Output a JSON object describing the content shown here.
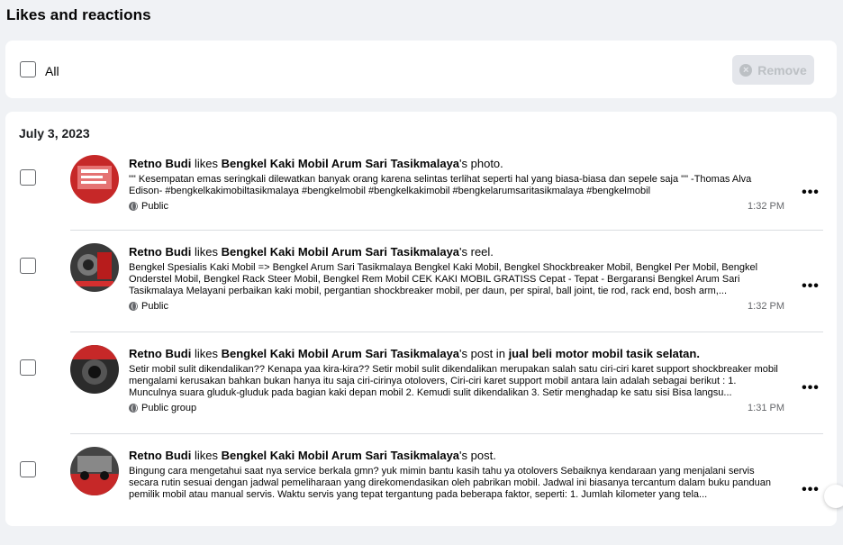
{
  "page": {
    "title": "Likes and reactions"
  },
  "toolbar": {
    "all_label": "All",
    "remove_label": "Remove"
  },
  "date_header": "July 3, 2023",
  "items": [
    {
      "actor": "Retno Budi",
      "verb": "likes",
      "page": "Bengkel Kaki Mobil Arum Sari Tasikmalaya",
      "suffix": "'s photo.",
      "group": "",
      "body": "\"\" Kesempatan emas seringkali dilewatkan banyak orang karena selintas terlihat seperti hal yang biasa-biasa dan sepele saja \"\" -Thomas Alva Edison- #bengkelkakimobiltasikmalaya #bengkelmobil #bengkelkakimobil #bengkelarumsaritasikmalaya #bengkelmobil",
      "privacy": "Public",
      "time": "1:32 PM",
      "thumb_color": "#c62828"
    },
    {
      "actor": "Retno Budi",
      "verb": "likes",
      "page": "Bengkel Kaki Mobil Arum Sari Tasikmalaya",
      "suffix": "'s reel.",
      "group": "",
      "body": "Bengkel Spesialis Kaki Mobil => Bengkel Arum Sari Tasikmalaya Bengkel Kaki Mobil, Bengkel Shockbreaker Mobil, Bengkel Per Mobil, Bengkel Onderstel Mobil, Bengkel Rack Steer Mobil, Bengkel Rem Mobil CEK KAKI MOBIL GRATISS Cepat - Tepat - Bergaransi Bengkel Arum Sari Tasikmalaya Melayani perbaikan kaki mobil, pergantian shockbreaker mobil, per daun, per spiral, ball joint, tie rod, rack end, bosh arm,...",
      "privacy": "Public",
      "time": "1:32 PM",
      "thumb_color": "#3a3a3a"
    },
    {
      "actor": "Retno Budi",
      "verb": "likes",
      "page": "Bengkel Kaki Mobil Arum Sari Tasikmalaya",
      "suffix": "'s post in",
      "group": "jual beli motor mobil tasik selatan.",
      "body": "Setir mobil sulit dikendalikan?? Kenapa yaa kira-kira?? Setir mobil sulit dikendalikan merupakan salah satu ciri-ciri karet support shockbreaker mobil mengalami kerusakan bahkan bukan hanya itu saja ciri-cirinya otolovers, Ciri-ciri karet support mobil antara lain adalah sebagai berikut : 1. Munculnya suara gluduk-gluduk pada bagian kaki depan mobil 2. Kemudi sulit dikendalikan 3. Setir menghadap ke satu sisi Bisa langsu...",
      "privacy": "Public group",
      "time": "1:31 PM",
      "thumb_color": "#2b2b2b"
    },
    {
      "actor": "Retno Budi",
      "verb": "likes",
      "page": "Bengkel Kaki Mobil Arum Sari Tasikmalaya",
      "suffix": "'s post.",
      "group": "",
      "body": "Bingung cara mengetahui saat nya service berkala gmn? yuk mimin bantu kasih tahu ya otolovers Sebaiknya kendaraan yang menjalani servis secara rutin sesuai dengan jadwal pemeliharaan yang direkomendasikan oleh pabrikan mobil. Jadwal ini biasanya tercantum dalam buku panduan pemilik mobil atau manual servis. Waktu servis yang tepat tergantung pada beberapa faktor, seperti: 1. Jumlah kilometer yang tela...",
      "privacy": "",
      "time": "",
      "thumb_color": "#444444"
    }
  ],
  "icons": {
    "remove": "close-circle-icon",
    "privacy": "globe-icon",
    "more": "more-horizontal-icon"
  }
}
